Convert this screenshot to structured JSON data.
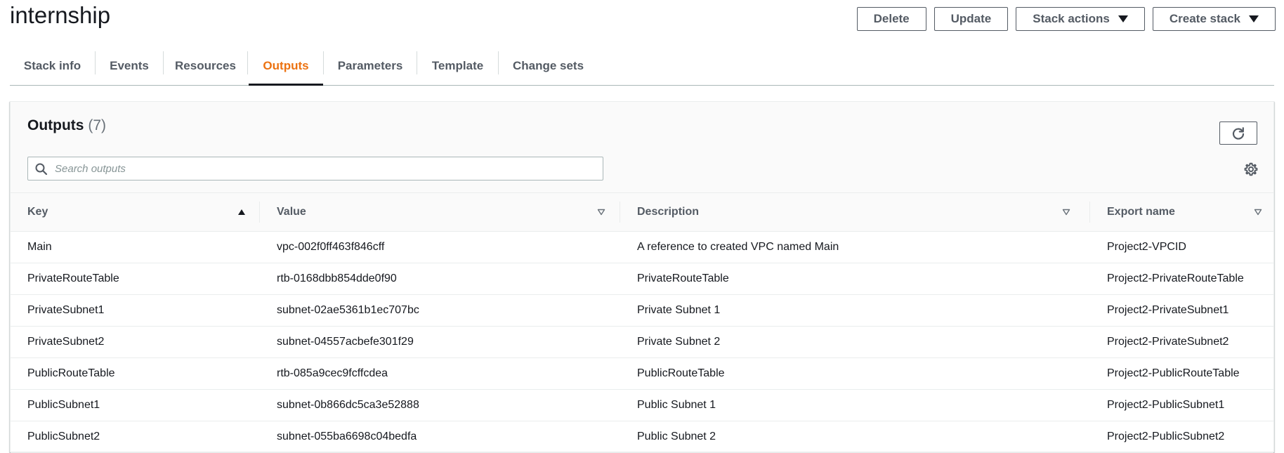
{
  "header": {
    "title": "internship",
    "buttons": {
      "delete": "Delete",
      "update": "Update",
      "stack_actions": "Stack actions",
      "create_stack": "Create stack"
    }
  },
  "tabs": [
    {
      "label": "Stack info",
      "active": false
    },
    {
      "label": "Events",
      "active": false
    },
    {
      "label": "Resources",
      "active": false
    },
    {
      "label": "Outputs",
      "active": true
    },
    {
      "label": "Parameters",
      "active": false
    },
    {
      "label": "Template",
      "active": false
    },
    {
      "label": "Change sets",
      "active": false
    }
  ],
  "outputs": {
    "title": "Outputs",
    "count": "(7)",
    "search_placeholder": "Search outputs",
    "columns": [
      "Key",
      "Value",
      "Description",
      "Export name"
    ],
    "sort": {
      "column": "Key",
      "direction": "ascending"
    },
    "rows": [
      [
        "Main",
        "vpc-002f0ff463f846cff",
        "A reference to created VPC named Main",
        "Project2-VPCID"
      ],
      [
        "PrivateRouteTable",
        "rtb-0168dbb854dde0f90",
        "PrivateRouteTable",
        "Project2-PrivateRouteTable"
      ],
      [
        "PrivateSubnet1",
        "subnet-02ae5361b1ec707bc",
        "Private Subnet 1",
        "Project2-PrivateSubnet1"
      ],
      [
        "PrivateSubnet2",
        "subnet-04557acbefe301f29",
        "Private Subnet 2",
        "Project2-PrivateSubnet2"
      ],
      [
        "PublicRouteTable",
        "rtb-085a9cec9fcffcdea",
        "PublicRouteTable",
        "Project2-PublicRouteTable"
      ],
      [
        "PublicSubnet1",
        "subnet-0b866dc5ca3e52888",
        "Public Subnet 1",
        "Project2-PublicSubnet1"
      ],
      [
        "PublicSubnet2",
        "subnet-055ba6698c04bedfa",
        "Public Subnet 2",
        "Project2-PublicSubnet2"
      ]
    ]
  },
  "icons": {
    "stack_actions_caret": "caret-down-icon",
    "create_stack_caret": "caret-down-icon",
    "refresh": "refresh-icon",
    "search": "search-icon",
    "settings": "gear-icon",
    "sort_ascending": "sort-ascending-icon",
    "sort_available": "sort-down-outline-icon"
  },
  "colors": {
    "accent_active_tab": "#ec7211",
    "text": "#16191f",
    "secondary_text": "#545b64",
    "border": "#eaeded"
  }
}
